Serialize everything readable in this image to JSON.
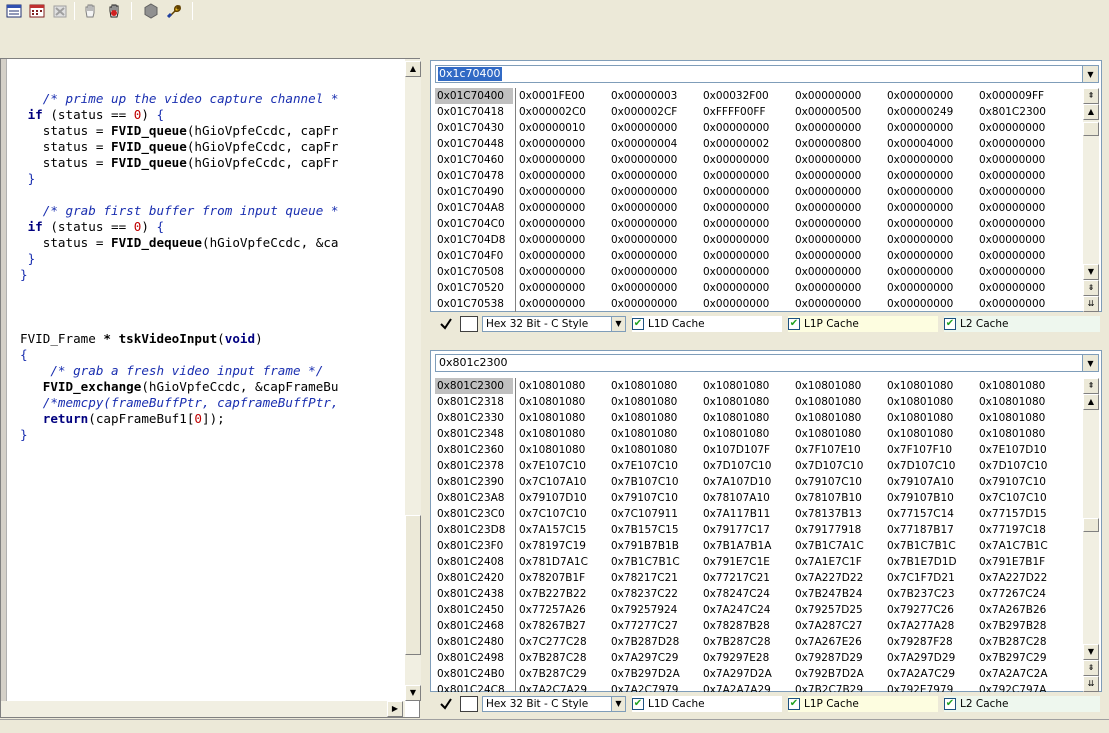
{
  "toolbar": {
    "buttons": [
      "memory-window-icon",
      "calendar-icon",
      "delete-icon",
      "hand-icon",
      "stop-hand-icon",
      "hexagon-icon",
      "wrench-icon"
    ]
  },
  "editor": {
    "lines": [
      [
        {
          "t": "   ",
          "c": "c-txt"
        },
        {
          "t": "/* prime up the video capture channel *",
          "c": "c-cmt"
        }
      ],
      [
        {
          "t": " ",
          "c": "c-txt"
        },
        {
          "t": "if",
          "c": "c-kw"
        },
        {
          "t": " (status == ",
          "c": "c-txt"
        },
        {
          "t": "0",
          "c": "c-num"
        },
        {
          "t": ") ",
          "c": "c-txt"
        },
        {
          "t": "{",
          "c": "c-brace"
        }
      ],
      [
        {
          "t": "   status = ",
          "c": "c-txt"
        },
        {
          "t": "FVID_queue",
          "c": "c-fn"
        },
        {
          "t": "(hGioVpfeCcdc, capFr",
          "c": "c-txt"
        }
      ],
      [
        {
          "t": "   status = ",
          "c": "c-txt"
        },
        {
          "t": "FVID_queue",
          "c": "c-fn"
        },
        {
          "t": "(hGioVpfeCcdc, capFr",
          "c": "c-txt"
        }
      ],
      [
        {
          "t": "   status = ",
          "c": "c-txt"
        },
        {
          "t": "FVID_queue",
          "c": "c-fn"
        },
        {
          "t": "(hGioVpfeCcdc, capFr",
          "c": "c-txt"
        }
      ],
      [
        {
          "t": " ",
          "c": "c-txt"
        },
        {
          "t": "}",
          "c": "c-brace"
        }
      ],
      [
        {
          "t": "",
          "c": "c-txt"
        }
      ],
      [
        {
          "t": "   ",
          "c": "c-txt"
        },
        {
          "t": "/* grab first buffer from input queue *",
          "c": "c-cmt"
        }
      ],
      [
        {
          "t": " ",
          "c": "c-txt"
        },
        {
          "t": "if",
          "c": "c-kw"
        },
        {
          "t": " (status == ",
          "c": "c-txt"
        },
        {
          "t": "0",
          "c": "c-num"
        },
        {
          "t": ") ",
          "c": "c-txt"
        },
        {
          "t": "{",
          "c": "c-brace"
        }
      ],
      [
        {
          "t": "   status = ",
          "c": "c-txt"
        },
        {
          "t": "FVID_dequeue",
          "c": "c-fn"
        },
        {
          "t": "(hGioVpfeCcdc, &ca",
          "c": "c-txt"
        }
      ],
      [
        {
          "t": " ",
          "c": "c-txt"
        },
        {
          "t": "}",
          "c": "c-brace"
        }
      ],
      [
        {
          "t": "}",
          "c": "c-brace"
        }
      ],
      [
        {
          "t": "",
          "c": "c-txt"
        }
      ],
      [
        {
          "t": "",
          "c": "c-txt"
        }
      ],
      [
        {
          "t": "",
          "c": "c-txt"
        }
      ],
      [
        {
          "t": "FVID_Frame ",
          "c": "c-txt"
        },
        {
          "t": "*",
          "c": "c-fn"
        },
        {
          "t": " ",
          "c": "c-txt"
        },
        {
          "t": "tskVideoInput",
          "c": "c-fn"
        },
        {
          "t": "(",
          "c": "c-txt"
        },
        {
          "t": "void",
          "c": "c-kw"
        },
        {
          "t": ")",
          "c": "c-txt"
        }
      ],
      [
        {
          "t": "{",
          "c": "c-brace"
        }
      ],
      [
        {
          "t": "    ",
          "c": "c-txt"
        },
        {
          "t": "/* grab a fresh video input frame */",
          "c": "c-cmt"
        }
      ],
      [
        {
          "t": "   ",
          "c": "c-txt"
        },
        {
          "t": "FVID_exchange",
          "c": "c-fn"
        },
        {
          "t": "(hGioVpfeCcdc, &capFrameBu",
          "c": "c-txt"
        }
      ],
      [
        {
          "t": "   ",
          "c": "c-txt"
        },
        {
          "t": "/*memcpy(frameBuffPtr, capframeBuffPtr,",
          "c": "c-cmt"
        }
      ],
      [
        {
          "t": "   ",
          "c": "c-txt"
        },
        {
          "t": "return",
          "c": "c-kw"
        },
        {
          "t": "(capFrameBuf1[",
          "c": "c-txt"
        },
        {
          "t": "0",
          "c": "c-num"
        },
        {
          "t": "]);",
          "c": "c-txt"
        }
      ],
      [
        {
          "t": "}",
          "c": "c-brace"
        }
      ]
    ]
  },
  "memory_top": {
    "address": "0x1c70400",
    "format": "Hex 32 Bit - C Style",
    "cache": {
      "l1d": "L1D Cache",
      "l1p": "L1P Cache",
      "l2": "L2 Cache"
    },
    "rows": [
      {
        "addr": "0x01C70400",
        "vals": [
          "0x0001FE00",
          "0x00000003",
          "0x00032F00",
          "0x00000000",
          "0x00000000",
          "0x000009FF"
        ]
      },
      {
        "addr": "0x01C70418",
        "vals": [
          "0x000002C0",
          "0x000002CF",
          "0xFFFF00FF",
          "0x00000500",
          "0x00000249",
          "0x801C2300"
        ]
      },
      {
        "addr": "0x01C70430",
        "vals": [
          "0x00000010",
          "0x00000000",
          "0x00000000",
          "0x00000000",
          "0x00000000",
          "0x00000000"
        ]
      },
      {
        "addr": "0x01C70448",
        "vals": [
          "0x00000000",
          "0x00000004",
          "0x00000002",
          "0x00000800",
          "0x00004000",
          "0x00000000"
        ]
      },
      {
        "addr": "0x01C70460",
        "vals": [
          "0x00000000",
          "0x00000000",
          "0x00000000",
          "0x00000000",
          "0x00000000",
          "0x00000000"
        ]
      },
      {
        "addr": "0x01C70478",
        "vals": [
          "0x00000000",
          "0x00000000",
          "0x00000000",
          "0x00000000",
          "0x00000000",
          "0x00000000"
        ]
      },
      {
        "addr": "0x01C70490",
        "vals": [
          "0x00000000",
          "0x00000000",
          "0x00000000",
          "0x00000000",
          "0x00000000",
          "0x00000000"
        ]
      },
      {
        "addr": "0x01C704A8",
        "vals": [
          "0x00000000",
          "0x00000000",
          "0x00000000",
          "0x00000000",
          "0x00000000",
          "0x00000000"
        ]
      },
      {
        "addr": "0x01C704C0",
        "vals": [
          "0x00000000",
          "0x00000000",
          "0x00000000",
          "0x00000000",
          "0x00000000",
          "0x00000000"
        ]
      },
      {
        "addr": "0x01C704D8",
        "vals": [
          "0x00000000",
          "0x00000000",
          "0x00000000",
          "0x00000000",
          "0x00000000",
          "0x00000000"
        ]
      },
      {
        "addr": "0x01C704F0",
        "vals": [
          "0x00000000",
          "0x00000000",
          "0x00000000",
          "0x00000000",
          "0x00000000",
          "0x00000000"
        ]
      },
      {
        "addr": "0x01C70508",
        "vals": [
          "0x00000000",
          "0x00000000",
          "0x00000000",
          "0x00000000",
          "0x00000000",
          "0x00000000"
        ]
      },
      {
        "addr": "0x01C70520",
        "vals": [
          "0x00000000",
          "0x00000000",
          "0x00000000",
          "0x00000000",
          "0x00000000",
          "0x00000000"
        ]
      },
      {
        "addr": "0x01C70538",
        "vals": [
          "0x00000000",
          "0x00000000",
          "0x00000000",
          "0x00000000",
          "0x00000000",
          "0x00000000"
        ]
      }
    ]
  },
  "memory_bottom": {
    "address": "0x801c2300",
    "format": "Hex 32 Bit - C Style",
    "cache": {
      "l1d": "L1D Cache",
      "l1p": "L1P Cache",
      "l2": "L2 Cache"
    },
    "rows": [
      {
        "addr": "0x801C2300",
        "vals": [
          "0x10801080",
          "0x10801080",
          "0x10801080",
          "0x10801080",
          "0x10801080",
          "0x10801080"
        ]
      },
      {
        "addr": "0x801C2318",
        "vals": [
          "0x10801080",
          "0x10801080",
          "0x10801080",
          "0x10801080",
          "0x10801080",
          "0x10801080"
        ]
      },
      {
        "addr": "0x801C2330",
        "vals": [
          "0x10801080",
          "0x10801080",
          "0x10801080",
          "0x10801080",
          "0x10801080",
          "0x10801080"
        ]
      },
      {
        "addr": "0x801C2348",
        "vals": [
          "0x10801080",
          "0x10801080",
          "0x10801080",
          "0x10801080",
          "0x10801080",
          "0x10801080"
        ]
      },
      {
        "addr": "0x801C2360",
        "vals": [
          "0x10801080",
          "0x10801080",
          "0x107D107F",
          "0x7F107E10",
          "0x7F107F10",
          "0x7E107D10"
        ]
      },
      {
        "addr": "0x801C2378",
        "vals": [
          "0x7E107C10",
          "0x7E107C10",
          "0x7D107C10",
          "0x7D107C10",
          "0x7D107C10",
          "0x7D107C10"
        ]
      },
      {
        "addr": "0x801C2390",
        "vals": [
          "0x7C107A10",
          "0x7B107C10",
          "0x7A107D10",
          "0x79107C10",
          "0x79107A10",
          "0x79107C10"
        ]
      },
      {
        "addr": "0x801C23A8",
        "vals": [
          "0x79107D10",
          "0x79107C10",
          "0x78107A10",
          "0x78107B10",
          "0x79107B10",
          "0x7C107C10"
        ]
      },
      {
        "addr": "0x801C23C0",
        "vals": [
          "0x7C107C10",
          "0x7C107911",
          "0x7A117B11",
          "0x78137B13",
          "0x77157C14",
          "0x77157D15"
        ]
      },
      {
        "addr": "0x801C23D8",
        "vals": [
          "0x7A157C15",
          "0x7B157C15",
          "0x79177C17",
          "0x79177918",
          "0x77187B17",
          "0x77197C18"
        ]
      },
      {
        "addr": "0x801C23F0",
        "vals": [
          "0x78197C19",
          "0x791B7B1B",
          "0x7B1A7B1A",
          "0x7B1C7A1C",
          "0x7B1C7B1C",
          "0x7A1C7B1C"
        ]
      },
      {
        "addr": "0x801C2408",
        "vals": [
          "0x781D7A1C",
          "0x7B1C7B1C",
          "0x791E7C1E",
          "0x7A1E7C1F",
          "0x7B1E7D1D",
          "0x791E7B1F"
        ]
      },
      {
        "addr": "0x801C2420",
        "vals": [
          "0x78207B1F",
          "0x78217C21",
          "0x77217C21",
          "0x7A227D22",
          "0x7C1F7D21",
          "0x7A227D22"
        ]
      },
      {
        "addr": "0x801C2438",
        "vals": [
          "0x7B227B22",
          "0x78237C22",
          "0x78247C24",
          "0x7B247B24",
          "0x7B237C23",
          "0x77267C24"
        ]
      },
      {
        "addr": "0x801C2450",
        "vals": [
          "0x77257A26",
          "0x79257924",
          "0x7A247C24",
          "0x79257D25",
          "0x79277C26",
          "0x7A267B26"
        ]
      },
      {
        "addr": "0x801C2468",
        "vals": [
          "0x78267B27",
          "0x77277C27",
          "0x78287B28",
          "0x7A287C27",
          "0x7A277A28",
          "0x7B297B28"
        ]
      },
      {
        "addr": "0x801C2480",
        "vals": [
          "0x7C277C28",
          "0x7B287D28",
          "0x7B287C28",
          "0x7A267E26",
          "0x79287F28",
          "0x7B287C28"
        ]
      },
      {
        "addr": "0x801C2498",
        "vals": [
          "0x7B287C28",
          "0x7A297C29",
          "0x79297E28",
          "0x79287D29",
          "0x7A297D29",
          "0x7B297C29"
        ]
      },
      {
        "addr": "0x801C24B0",
        "vals": [
          "0x7B287C29",
          "0x7B297D2A",
          "0x7A297D2A",
          "0x792B7D2A",
          "0x7A2A7C29",
          "0x7A2A7C2A"
        ]
      },
      {
        "addr": "0x801C24C8",
        "vals": [
          "0x7A2C7A29",
          "0x7A2C7979",
          "0x7A2A7A29",
          "0x7B2C7B29",
          "0x792E7979",
          "0x792C797A"
        ]
      }
    ]
  }
}
